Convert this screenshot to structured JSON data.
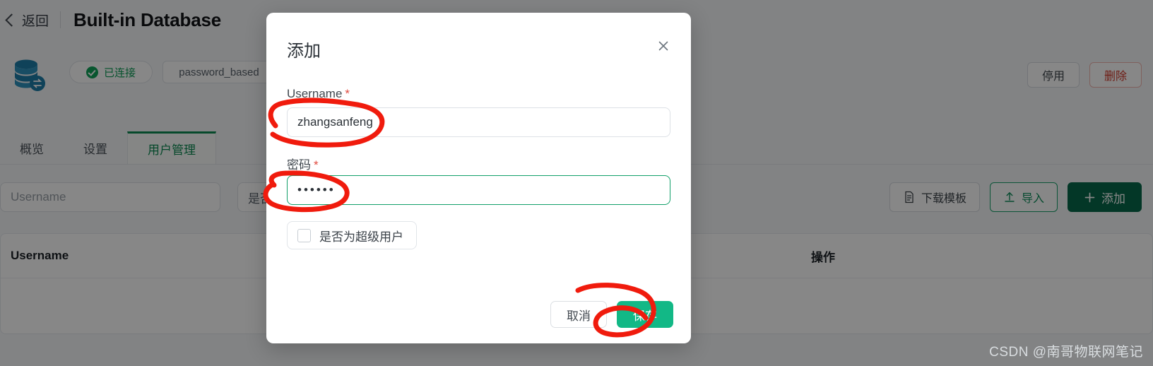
{
  "topbar": {
    "back_label": "返回",
    "back_icon": "chevron-left-icon",
    "title": "Built-in Database"
  },
  "info": {
    "db_icon": "database-sync-icon",
    "status_label": "已连接",
    "status_icon": "check-circle-icon",
    "status_color": "#0f9d58",
    "auth_label": "password_based"
  },
  "top_actions": {
    "disable_label": "停用",
    "delete_label": "删除",
    "delete_color": "#d1392b"
  },
  "tabs": [
    {
      "label": "概览",
      "active": false
    },
    {
      "label": "设置",
      "active": false
    },
    {
      "label": "用户管理",
      "active": true
    }
  ],
  "tab_accent": "#0d8a52",
  "filters": {
    "search_placeholder": "Username",
    "search_value": "",
    "select_label": "是否为超级用户"
  },
  "right_actions": {
    "download_template_label": "下载模板",
    "download_template_icon": "file-icon",
    "import_label": "导入",
    "import_icon": "upload-icon",
    "add_label": "添加",
    "add_icon": "plus-icon",
    "add_color": "#06694a"
  },
  "table": {
    "columns": [
      "Username",
      "操作"
    ],
    "rows": []
  },
  "modal": {
    "title": "添加",
    "close_icon": "close-icon",
    "fields": [
      {
        "label": "Username",
        "required_mark": "*",
        "value": "zhangsanfeng",
        "placeholder": ""
      },
      {
        "label": "密码",
        "required_mark": "*",
        "value": "••••••",
        "placeholder": ""
      }
    ],
    "checkbox": {
      "label": "是否为超级用户",
      "checked": false
    },
    "cancel_label": "取消",
    "save_label": "保存",
    "save_color": "#12b886",
    "focus_color": "#12a06a"
  },
  "annotations": {
    "color": "#f01b0d",
    "marks": [
      "username-input-circle",
      "password-input-circle",
      "save-button-circle"
    ]
  },
  "watermark": {
    "text": "CSDN @南哥物联网笔记"
  }
}
